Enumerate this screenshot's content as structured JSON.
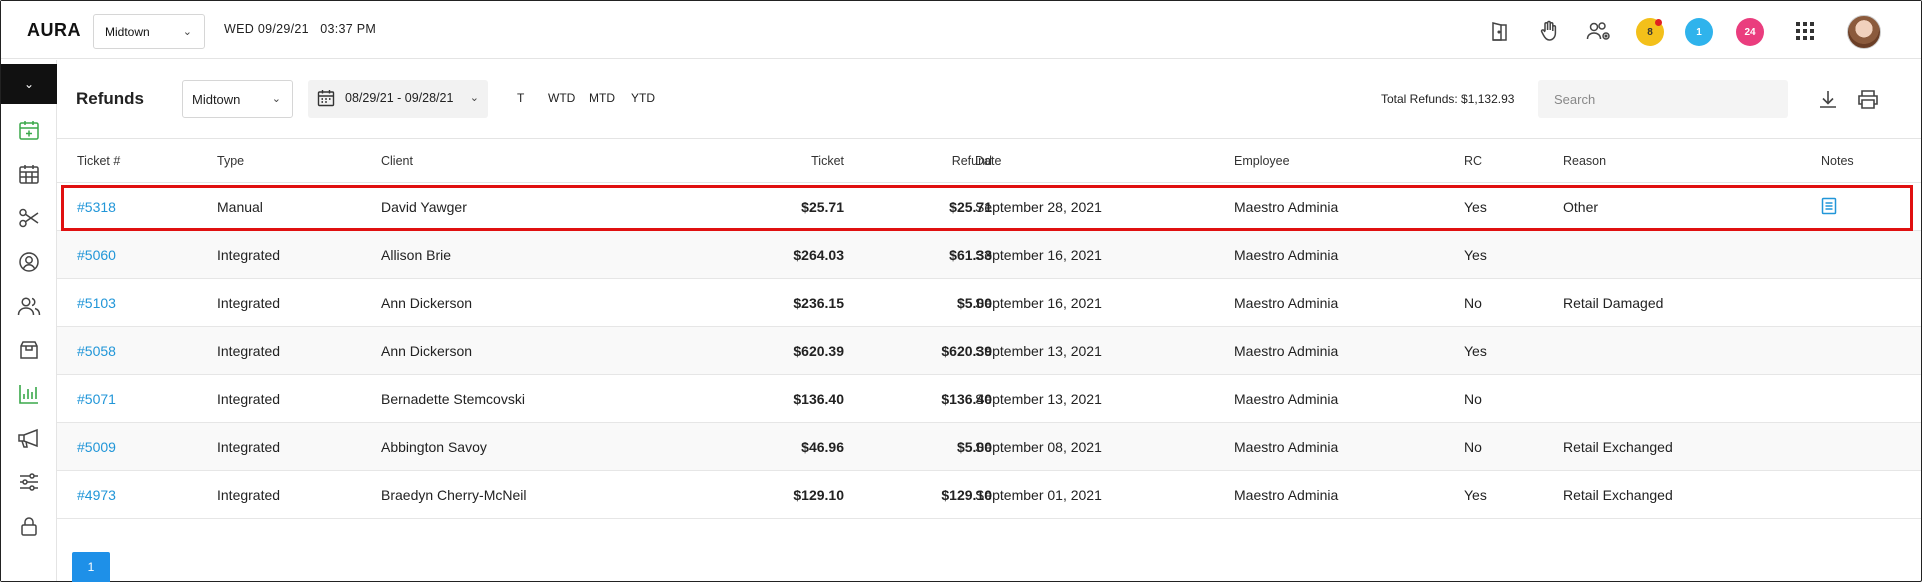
{
  "app": {
    "brand": "AURA",
    "location": "Midtown",
    "datetime": "WED 09/29/21   03:37 PM",
    "badges": {
      "alerts": "8",
      "messages": "1",
      "notifications": "24"
    }
  },
  "sidebar": {
    "icons": [
      "calendar-add-icon",
      "calendar-icon",
      "scissors-icon",
      "user-circle-icon",
      "users-icon",
      "box-icon",
      "bar-chart-icon",
      "megaphone-icon",
      "sliders-icon",
      "lock-icon"
    ],
    "active": "bar-chart-icon"
  },
  "page": {
    "title": "Refunds",
    "location_filter": "Midtown",
    "date_range": "08/29/21 - 09/28/21",
    "periods": [
      "T",
      "WTD",
      "MTD",
      "YTD"
    ],
    "total_refunds": "Total Refunds: $1,132.93",
    "search_placeholder": "Search"
  },
  "table": {
    "columns": {
      "ticket": "Ticket #",
      "type": "Type",
      "client": "Client",
      "ticket_amount": "Ticket",
      "refund": "Refund",
      "date": "Date",
      "employee": "Employee",
      "rc": "RC",
      "reason": "Reason",
      "notes": "Notes"
    },
    "rows": [
      {
        "ticket": "#5318",
        "type": "Manual",
        "client": "David Yawger",
        "ticket_amount": "$25.71",
        "refund": "$25.71",
        "date": "September 28, 2021",
        "employee": "Maestro Adminia",
        "rc": "Yes",
        "reason": "Other",
        "has_note": true,
        "highlighted": true
      },
      {
        "ticket": "#5060",
        "type": "Integrated",
        "client": "Allison Brie",
        "ticket_amount": "$264.03",
        "refund": "$61.33",
        "date": "September 16, 2021",
        "employee": "Maestro Adminia",
        "rc": "Yes",
        "reason": ""
      },
      {
        "ticket": "#5103",
        "type": "Integrated",
        "client": "Ann Dickerson",
        "ticket_amount": "$236.15",
        "refund": "$5.00",
        "date": "September 16, 2021",
        "employee": "Maestro Adminia",
        "rc": "No",
        "reason": "Retail Damaged"
      },
      {
        "ticket": "#5058",
        "type": "Integrated",
        "client": "Ann Dickerson",
        "ticket_amount": "$620.39",
        "refund": "$620.39",
        "date": "September 13, 2021",
        "employee": "Maestro Adminia",
        "rc": "Yes",
        "reason": ""
      },
      {
        "ticket": "#5071",
        "type": "Integrated",
        "client": "Bernadette Stemcovski",
        "ticket_amount": "$136.40",
        "refund": "$136.40",
        "date": "September 13, 2021",
        "employee": "Maestro Adminia",
        "rc": "No",
        "reason": ""
      },
      {
        "ticket": "#5009",
        "type": "Integrated",
        "client": "Abbington Savoy",
        "ticket_amount": "$46.96",
        "refund": "$5.00",
        "date": "September 08, 2021",
        "employee": "Maestro Adminia",
        "rc": "No",
        "reason": "Retail Exchanged"
      },
      {
        "ticket": "#4973",
        "type": "Integrated",
        "client": "Braedyn Cherry-McNeil",
        "ticket_amount": "$129.10",
        "refund": "$129.10",
        "date": "September 01, 2021",
        "employee": "Maestro Adminia",
        "rc": "Yes",
        "reason": "Retail Exchanged"
      }
    ]
  },
  "pagination": {
    "current_page": "1"
  },
  "colors": {
    "accent": "#2196d8",
    "active_nav": "#3aa84a",
    "highlight": "#e01010"
  }
}
